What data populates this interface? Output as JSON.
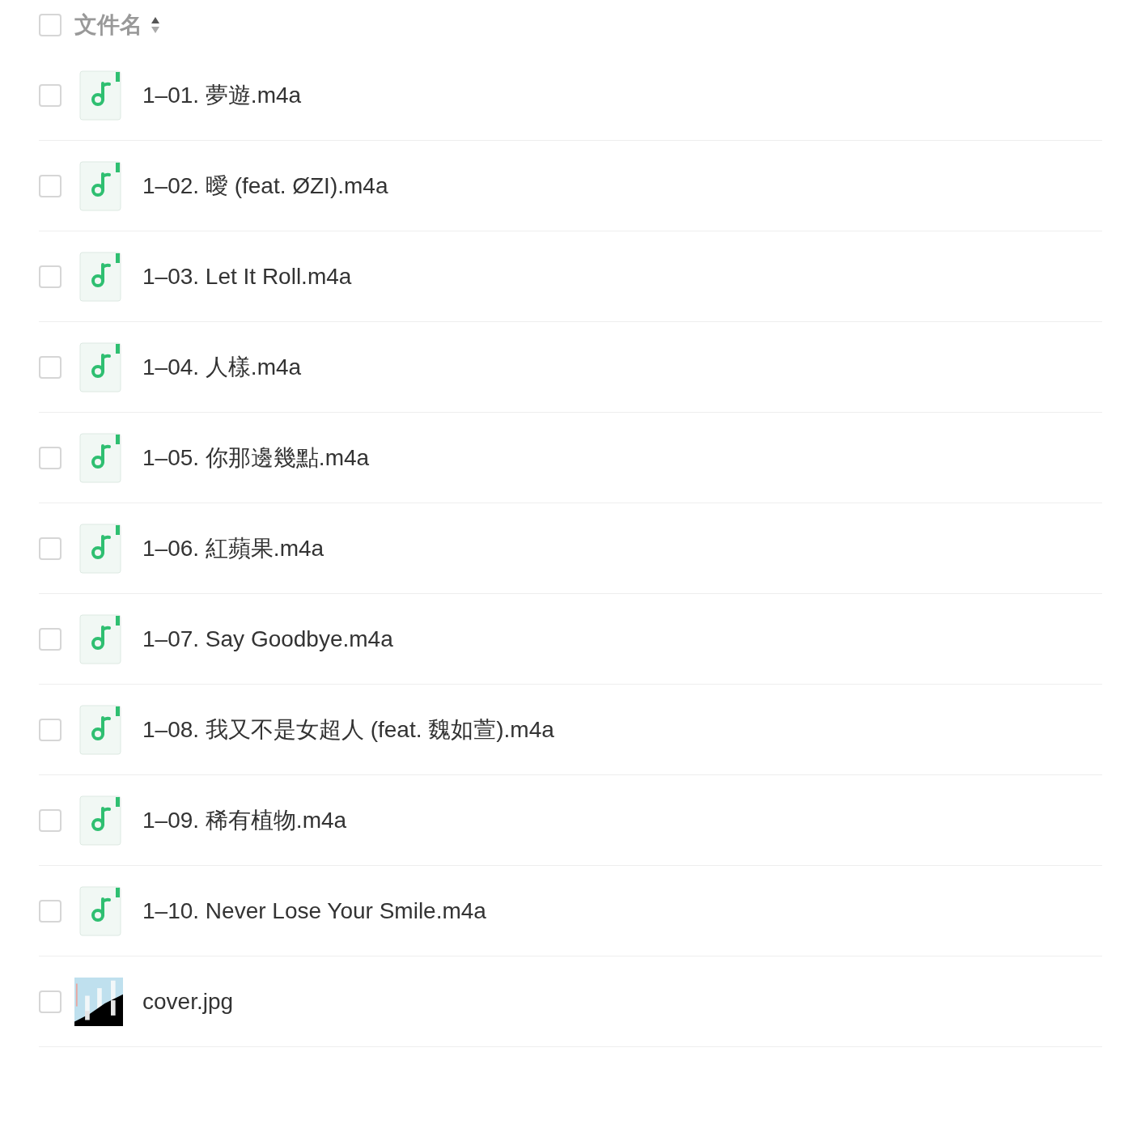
{
  "header": {
    "label": "文件名",
    "checked": false
  },
  "files": [
    {
      "name": "1–01. 夢遊.m4a",
      "kind": "audio",
      "checked": false
    },
    {
      "name": "1–02. 曖 (feat. ØZI).m4a",
      "kind": "audio",
      "checked": false
    },
    {
      "name": "1–03. Let It Roll.m4a",
      "kind": "audio",
      "checked": false
    },
    {
      "name": "1–04. 人樣.m4a",
      "kind": "audio",
      "checked": false
    },
    {
      "name": "1–05. 你那邊幾點.m4a",
      "kind": "audio",
      "checked": false
    },
    {
      "name": "1–06. 紅蘋果.m4a",
      "kind": "audio",
      "checked": false
    },
    {
      "name": "1–07. Say Goodbye.m4a",
      "kind": "audio",
      "checked": false
    },
    {
      "name": "1–08. 我又不是女超人 (feat. 魏如萱).m4a",
      "kind": "audio",
      "checked": false
    },
    {
      "name": "1–09. 稀有植物.m4a",
      "kind": "audio",
      "checked": false
    },
    {
      "name": "1–10. Never Lose Your Smile.m4a",
      "kind": "audio",
      "checked": false
    },
    {
      "name": "cover.jpg",
      "checked": false
    }
  ]
}
